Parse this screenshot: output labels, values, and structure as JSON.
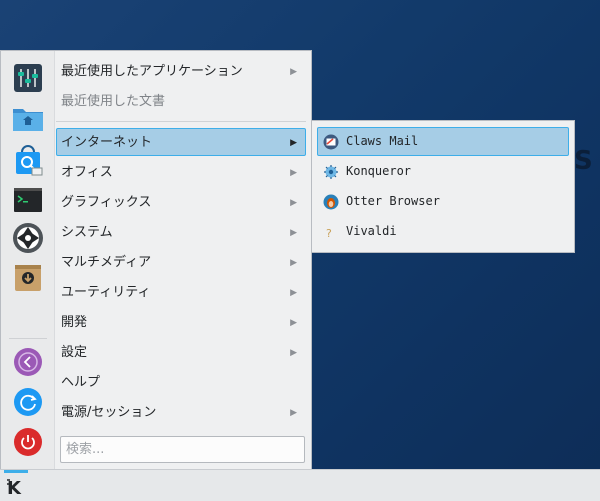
{
  "desktop": {
    "glyph": "S"
  },
  "favorites": [
    {
      "name": "mixer-icon"
    },
    {
      "name": "home-folder-icon"
    },
    {
      "name": "software-center-icon"
    },
    {
      "name": "terminal-icon"
    },
    {
      "name": "aperture-icon"
    },
    {
      "name": "archive-icon"
    },
    {
      "name": "lock-icon"
    },
    {
      "name": "refresh-icon"
    },
    {
      "name": "power-icon"
    }
  ],
  "categories": [
    {
      "label": "最近使用したアプリケーション",
      "submenu": true,
      "disabled": false
    },
    {
      "label": "最近使用した文書",
      "submenu": false,
      "disabled": true
    },
    {
      "label": "インターネット",
      "submenu": true,
      "disabled": false,
      "active": true
    },
    {
      "label": "オフィス",
      "submenu": true,
      "disabled": false
    },
    {
      "label": "グラフィックス",
      "submenu": true,
      "disabled": false
    },
    {
      "label": "システム",
      "submenu": true,
      "disabled": false
    },
    {
      "label": "マルチメディア",
      "submenu": true,
      "disabled": false
    },
    {
      "label": "ユーティリティ",
      "submenu": true,
      "disabled": false
    },
    {
      "label": "開発",
      "submenu": true,
      "disabled": false
    },
    {
      "label": "設定",
      "submenu": true,
      "disabled": false
    },
    {
      "label": "ヘルプ",
      "submenu": false,
      "disabled": false
    },
    {
      "label": "電源/セッション",
      "submenu": true,
      "disabled": false
    }
  ],
  "search": {
    "placeholder": "検索..."
  },
  "submenu": {
    "items": [
      {
        "label": "Claws Mail",
        "icon": "claws-mail-icon",
        "active": true
      },
      {
        "label": "Konqueror",
        "icon": "konqueror-icon"
      },
      {
        "label": "Otter Browser",
        "icon": "otter-browser-icon"
      },
      {
        "label": "Vivaldi",
        "icon": "vivaldi-icon"
      }
    ]
  },
  "taskbar": {
    "launcher": "kde-launcher-icon"
  },
  "colors": {
    "accent": "#3daee9",
    "highlight": "#a6cde6",
    "menu_bg": "#eff0f1",
    "lock": "#9b59b6",
    "refresh": "#1d99f3",
    "power": "#da2b2b"
  }
}
